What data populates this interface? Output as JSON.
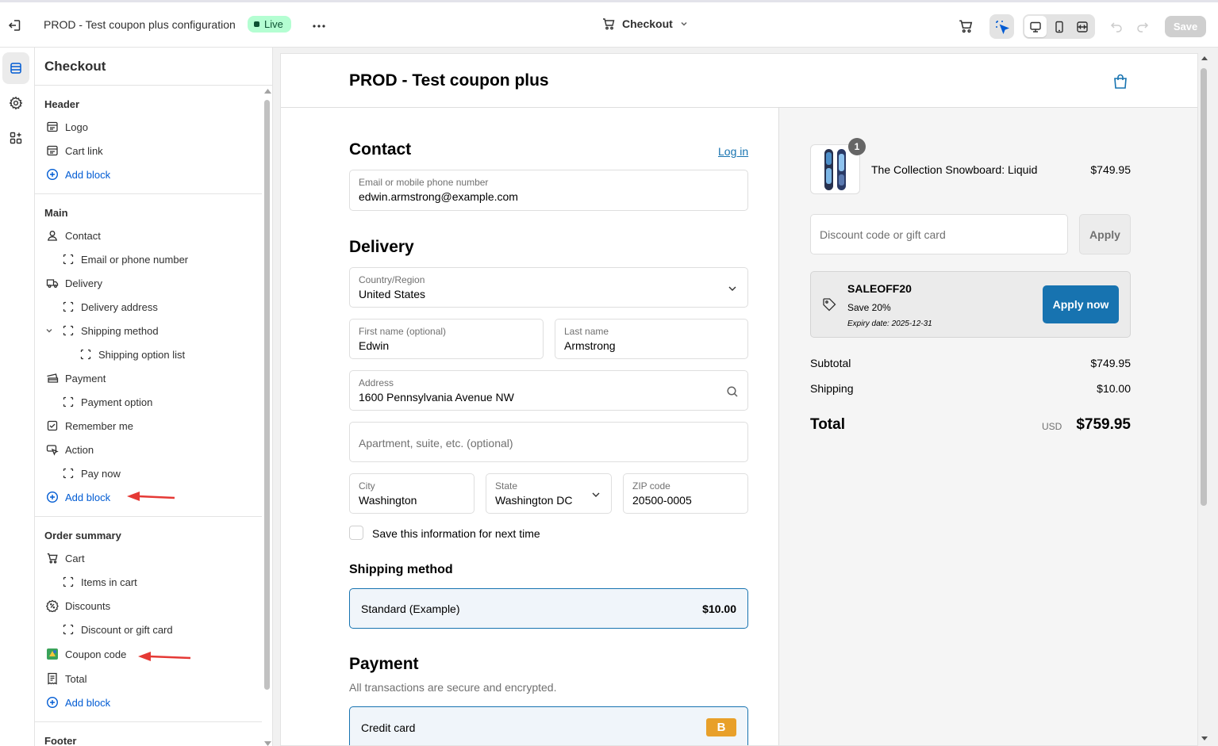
{
  "topbar": {
    "theme_title": "PROD - Test coupon plus configuration",
    "status": "Live",
    "page_selector": "Checkout",
    "save_label": "Save"
  },
  "panel": {
    "title": "Checkout",
    "sections": {
      "header": {
        "title": "Header",
        "items": [
          "Logo",
          "Cart link"
        ],
        "add": "Add block"
      },
      "main": {
        "title": "Main",
        "contact": "Contact",
        "email_phone": "Email or phone number",
        "delivery": "Delivery",
        "delivery_address": "Delivery address",
        "shipping_method": "Shipping method",
        "shipping_option_list": "Shipping option list",
        "payment": "Payment",
        "payment_option": "Payment option",
        "remember_me": "Remember me",
        "action": "Action",
        "pay_now": "Pay now",
        "add": "Add block"
      },
      "order_summary": {
        "title": "Order summary",
        "cart": "Cart",
        "items_in_cart": "Items in cart",
        "discounts": "Discounts",
        "discount_gift": "Discount or gift card",
        "coupon_code": "Coupon code",
        "total": "Total",
        "add": "Add block"
      },
      "footer": {
        "title": "Footer"
      }
    }
  },
  "preview": {
    "store_name": "PROD - Test coupon plus",
    "contact": {
      "heading": "Contact",
      "login": "Log in",
      "email_label": "Email or mobile phone number",
      "email_value": "edwin.armstrong@example.com"
    },
    "delivery": {
      "heading": "Delivery",
      "country_label": "Country/Region",
      "country_value": "United States",
      "first_label": "First name (optional)",
      "first_value": "Edwin",
      "last_label": "Last name",
      "last_value": "Armstrong",
      "address_label": "Address",
      "address_value": "1600 Pennsylvania Avenue NW",
      "apt_placeholder": "Apartment, suite, etc. (optional)",
      "city_label": "City",
      "city_value": "Washington",
      "state_label": "State",
      "state_value": "Washington DC",
      "zip_label": "ZIP code",
      "zip_value": "20500-0005",
      "save_info": "Save this information for next time"
    },
    "shipping": {
      "heading": "Shipping method",
      "option": "Standard (Example)",
      "price": "$10.00"
    },
    "payment": {
      "heading": "Payment",
      "subtitle": "All transactions are secure and encrypted.",
      "method": "Credit card",
      "badge": "B"
    },
    "summary": {
      "quantity": "1",
      "product": "The Collection Snowboard: Liquid",
      "product_price": "$749.95",
      "discount_placeholder": "Discount code or gift card",
      "apply": "Apply",
      "coupon_code": "SALEOFF20",
      "coupon_desc": "Save 20%",
      "coupon_expiry": "Expiry date: 2025-12-31",
      "apply_now": "Apply now",
      "subtotal_label": "Subtotal",
      "subtotal_value": "$749.95",
      "shipping_label": "Shipping",
      "shipping_value": "$10.00",
      "total_label": "Total",
      "currency": "USD",
      "total_value": "$759.95"
    }
  },
  "colors": {
    "accent": "#1773b0",
    "live_bg": "#b4fed2",
    "arrow": "#e53935",
    "blue_link": "#005bd3"
  }
}
